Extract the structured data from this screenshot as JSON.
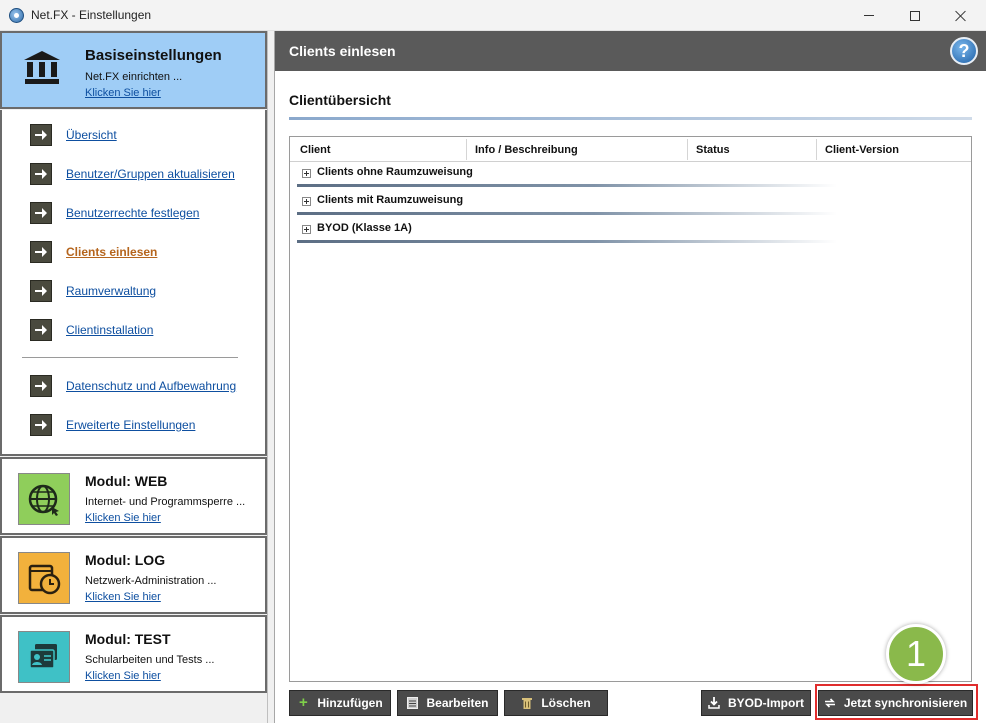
{
  "window": {
    "title": "Net.FX - Einstellungen"
  },
  "sidebar": {
    "base": {
      "title": "Basiseinstellungen",
      "subtitle": "Net.FX einrichten ...",
      "link": "Klicken Sie hier"
    },
    "nav": [
      {
        "label": "Übersicht"
      },
      {
        "label": "Benutzer/Gruppen aktualisieren"
      },
      {
        "label": "Benutzerrechte festlegen"
      },
      {
        "label": "Clients einlesen"
      },
      {
        "label": "Raumverwaltung"
      },
      {
        "label": "Clientinstallation"
      },
      {
        "label": "Datenschutz und Aufbewahrung"
      },
      {
        "label": "Erweiterte Einstellungen"
      }
    ],
    "active_item": "Clients einlesen",
    "modules": [
      {
        "title": "Modul: WEB",
        "subtitle": "Internet- und Programmsperre ...",
        "link": "Klicken Sie hier",
        "icon": "globe-icon",
        "color": "#8fce5b"
      },
      {
        "title": "Modul: LOG",
        "subtitle": "Netzwerk-Administration ...",
        "link": "Klicken Sie hier",
        "icon": "clock-folder-icon",
        "color": "#f2b13c"
      },
      {
        "title": "Modul: TEST",
        "subtitle": "Schularbeiten und Tests ...",
        "link": "Klicken Sie hier",
        "icon": "id-card-icon",
        "color": "#3fc1c6"
      }
    ]
  },
  "main": {
    "header_title": "Clients einlesen",
    "help_label": "?",
    "section_title": "Clientübersicht",
    "columns": [
      "Client",
      "Info / Beschreibung",
      "Status",
      "Client-Version"
    ],
    "groups": [
      {
        "label": "Clients ohne Raumzuweisung"
      },
      {
        "label": "Clients mit Raumzuweisung"
      },
      {
        "label": "BYOD (Klasse 1A)"
      }
    ],
    "buttons": {
      "add": "Hinzufügen",
      "edit": "Bearbeiten",
      "delete": "Löschen",
      "byod_import": "BYOD-Import",
      "sync": "Jetzt synchronisieren"
    },
    "callout_number": "1"
  }
}
